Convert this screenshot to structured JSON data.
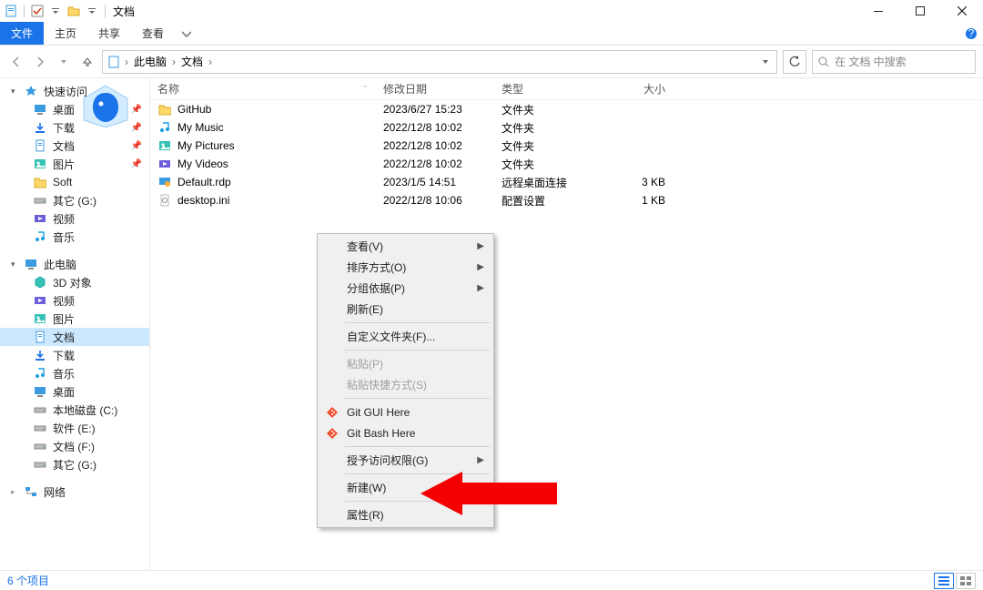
{
  "window": {
    "title": "文档",
    "sys": {
      "min": "—",
      "max": "▢",
      "close": "✕"
    }
  },
  "ribbon": {
    "file": "文件",
    "home": "主页",
    "share": "共享",
    "view": "查看"
  },
  "nav": {
    "breadcrumbs": [
      "此电脑",
      "文档"
    ],
    "search_placeholder": "在 文档 中搜索"
  },
  "sidebar": {
    "quick_access": "快速访问",
    "items_qa": [
      {
        "label": "桌面",
        "icon": "desktop",
        "pinned": true
      },
      {
        "label": "下载",
        "icon": "download",
        "pinned": true
      },
      {
        "label": "文档",
        "icon": "document",
        "pinned": true
      },
      {
        "label": "图片",
        "icon": "pictures",
        "pinned": true
      },
      {
        "label": "Soft",
        "icon": "folder",
        "pinned": false
      },
      {
        "label": "其它 (G:)",
        "icon": "drive",
        "pinned": false
      },
      {
        "label": "视频",
        "icon": "video",
        "pinned": false
      },
      {
        "label": "音乐",
        "icon": "music",
        "pinned": false
      }
    ],
    "this_pc": "此电脑",
    "items_pc": [
      {
        "label": "3D 对象",
        "icon": "3d"
      },
      {
        "label": "视频",
        "icon": "video"
      },
      {
        "label": "图片",
        "icon": "pictures"
      },
      {
        "label": "文档",
        "icon": "document",
        "selected": true
      },
      {
        "label": "下载",
        "icon": "download"
      },
      {
        "label": "音乐",
        "icon": "music"
      },
      {
        "label": "桌面",
        "icon": "desktop"
      },
      {
        "label": "本地磁盘 (C:)",
        "icon": "drive"
      },
      {
        "label": "软件 (E:)",
        "icon": "drive"
      },
      {
        "label": "文档 (F:)",
        "icon": "drive"
      },
      {
        "label": "其它 (G:)",
        "icon": "drive"
      }
    ],
    "network": "网络"
  },
  "columns": {
    "name": "名称",
    "date": "修改日期",
    "type": "类型",
    "size": "大小"
  },
  "files": [
    {
      "name": "GitHub",
      "date": "2023/6/27 15:23",
      "type": "文件夹",
      "size": "",
      "icon": "folder"
    },
    {
      "name": "My Music",
      "date": "2022/12/8 10:02",
      "type": "文件夹",
      "size": "",
      "icon": "music"
    },
    {
      "name": "My Pictures",
      "date": "2022/12/8 10:02",
      "type": "文件夹",
      "size": "",
      "icon": "pictures"
    },
    {
      "name": "My Videos",
      "date": "2022/12/8 10:02",
      "type": "文件夹",
      "size": "",
      "icon": "video"
    },
    {
      "name": "Default.rdp",
      "date": "2023/1/5 14:51",
      "type": "远程桌面连接",
      "size": "3 KB",
      "icon": "rdp"
    },
    {
      "name": "desktop.ini",
      "date": "2022/12/8 10:06",
      "type": "配置设置",
      "size": "1 KB",
      "icon": "ini"
    }
  ],
  "context_menu": [
    {
      "label": "查看(V)",
      "submenu": true
    },
    {
      "label": "排序方式(O)",
      "submenu": true
    },
    {
      "label": "分组依据(P)",
      "submenu": true
    },
    {
      "label": "刷新(E)"
    },
    {
      "sep": true
    },
    {
      "label": "自定义文件夹(F)..."
    },
    {
      "sep": true
    },
    {
      "label": "粘贴(P)",
      "disabled": true
    },
    {
      "label": "粘贴快捷方式(S)",
      "disabled": true
    },
    {
      "sep": true
    },
    {
      "label": "Git GUI Here",
      "icon": "git"
    },
    {
      "label": "Git Bash Here",
      "icon": "git"
    },
    {
      "sep": true
    },
    {
      "label": "授予访问权限(G)",
      "submenu": true
    },
    {
      "sep": true
    },
    {
      "label": "新建(W)",
      "submenu": true
    },
    {
      "sep": true
    },
    {
      "label": "属性(R)"
    }
  ],
  "status": {
    "count": "6 个项目"
  },
  "colors": {
    "accent": "#1a73e8",
    "arrow": "#f40000"
  }
}
